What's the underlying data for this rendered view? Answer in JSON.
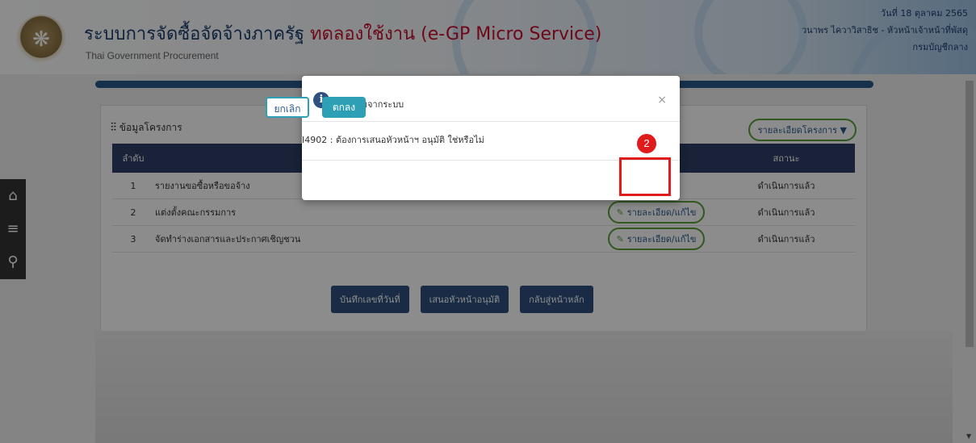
{
  "header": {
    "title": "ระบบการจัดซื้อจัดจ้างภาครัฐ",
    "trial_label": "ทดลองใช้งาน (e-GP Micro Service)",
    "subtitle": "Thai Government Procurement",
    "date": "วันที่ 18 ตุลาคม 2565",
    "user": "วนาพร ไควาวิสาธิช - หัวหน้าเจ้าหน้าที่พัสดุ",
    "department": "กรมบัญชีกลาง"
  },
  "sidebar": {
    "home_icon": "home-icon",
    "menu_icon": "menu-icon",
    "search_icon": "search-icon"
  },
  "project_card": {
    "title": "ข้อมูลโครงการ",
    "detail_button": "รายละเอียดโครงการ ▼",
    "columns": [
      "ลำดับ",
      "สถานะ"
    ],
    "rows": [
      {
        "index": "1",
        "name": "รายงานขอซื้อหรือขอจ้าง",
        "action": "",
        "status": "ดำเนินการแล้ว"
      },
      {
        "index": "2",
        "name": "แต่งตั้งคณะกรรมการ",
        "action": "รายละเอียด/แก้ไข",
        "status": "ดำเนินการแล้ว"
      },
      {
        "index": "3",
        "name": "จัดทำร่างเอกสารและประกาศเชิญชวน",
        "action": "รายละเอียด/แก้ไข",
        "status": "ดำเนินการแล้ว"
      }
    ]
  },
  "actions": {
    "save_number": "บันทึกเลขที่วันที่",
    "propose": "เสนอหัวหน้าอนุมัติ",
    "back_home": "กลับสู่หน้าหลัก"
  },
  "modal": {
    "title": "ข้อความจากระบบ",
    "message": "I4902 : ต้องการเสนอหัวหน้าฯ อนุมัติ ใช่หรือไม่",
    "cancel_label": "ยกเลิก",
    "ok_label": "ตกลง",
    "close_symbol": "×"
  },
  "annotation": {
    "step_number": "2",
    "highlight_color": "#e01b1b"
  }
}
